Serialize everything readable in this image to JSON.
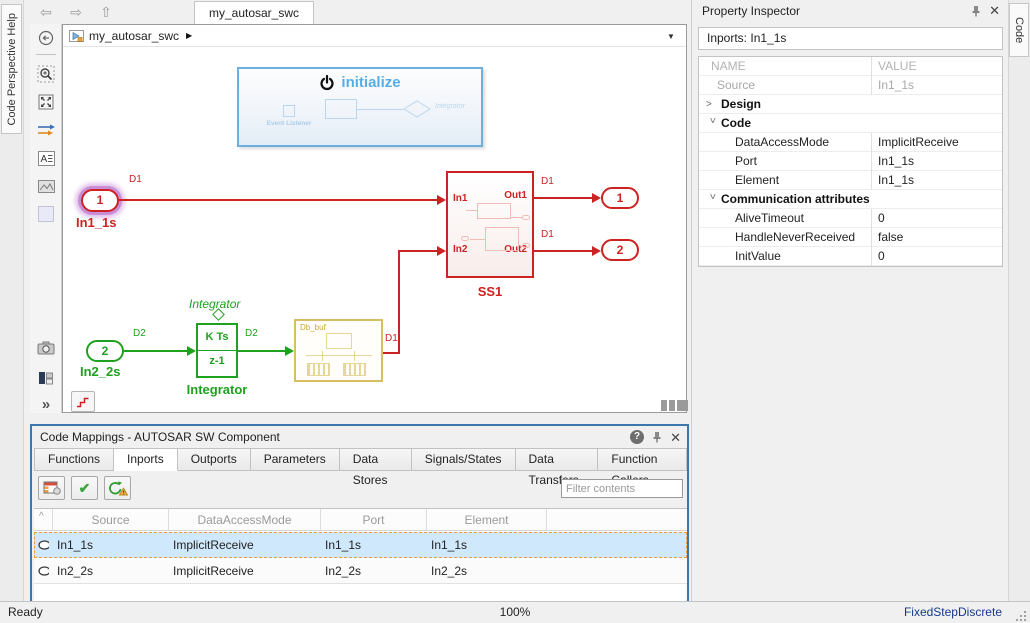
{
  "left_rail": {
    "tab_label": "Code Perspective Help"
  },
  "right_rail": {
    "tab_label": "Code"
  },
  "document_tabs": {
    "active": "my_autosar_swc"
  },
  "breadcrumb": {
    "model": "my_autosar_swc",
    "caret": "▶"
  },
  "diagram": {
    "initialize_block": {
      "title": "initialize",
      "event_listener_label": "Event Listener",
      "integrator_label": "Integrator"
    },
    "inport1": {
      "number": "1",
      "name": "In1_1s",
      "signal": "D1"
    },
    "inport2": {
      "number": "2",
      "name": "In2_2s",
      "signal": "D2"
    },
    "integrator": {
      "top": "K Ts",
      "bottom": "z-1",
      "name": "Integrator",
      "annotation": "Integrator",
      "out_signal": "D2"
    },
    "buffer": {
      "name": "Db_buf",
      "out_signal": "D1"
    },
    "ss1": {
      "name": "SS1",
      "in1": "In1",
      "in2": "In2",
      "out1": "Out1",
      "out2": "Out2",
      "out1_signal": "D1",
      "out2_signal": "D1"
    },
    "outport1": {
      "number": "1"
    },
    "outport2": {
      "number": "2"
    }
  },
  "property_inspector": {
    "title": "Property Inspector",
    "context": "Inports: In1_1s",
    "col_name": "NAME",
    "col_value": "VALUE",
    "source_row": {
      "name": "Source",
      "value": "In1_1s"
    },
    "sections": [
      {
        "label": "Design"
      },
      {
        "label": "Code",
        "rows": [
          {
            "name": "DataAccessMode",
            "value": "ImplicitReceive"
          },
          {
            "name": "Port",
            "value": "In1_1s"
          },
          {
            "name": "Element",
            "value": "In1_1s"
          }
        ]
      },
      {
        "label": "Communication attributes",
        "rows": [
          {
            "name": "AliveTimeout",
            "value": "0"
          },
          {
            "name": "HandleNeverReceived",
            "value": "false"
          },
          {
            "name": "InitValue",
            "value": "0"
          }
        ]
      }
    ]
  },
  "code_mappings": {
    "title": "Code Mappings - AUTOSAR SW Component",
    "tabs": [
      "Functions",
      "Inports",
      "Outports",
      "Parameters",
      "Data Stores",
      "Signals/States",
      "Data Transfers",
      "Function Callers"
    ],
    "active_tab": "Inports",
    "filter_placeholder": "Filter contents",
    "table": {
      "columns": [
        "Source",
        "DataAccessMode",
        "Port",
        "Element"
      ],
      "rows": [
        {
          "source": "In1_1s",
          "mode": "ImplicitReceive",
          "port": "In1_1s",
          "element": "In1_1s"
        },
        {
          "source": "In2_2s",
          "mode": "ImplicitReceive",
          "port": "In2_2s",
          "element": "In2_2s"
        }
      ]
    }
  },
  "status_bar": {
    "left": "Ready",
    "zoom": "100%",
    "right": "FixedStepDiscrete"
  },
  "colors": {
    "accent_blue": "#6db0e0",
    "block_red": "#cc2222",
    "block_green": "#1ea11e",
    "block_yellow": "#d8be62",
    "selection_purple": "#c98fd6",
    "panel_border_blue": "#3c76ad",
    "solver_text": "#16388e"
  }
}
